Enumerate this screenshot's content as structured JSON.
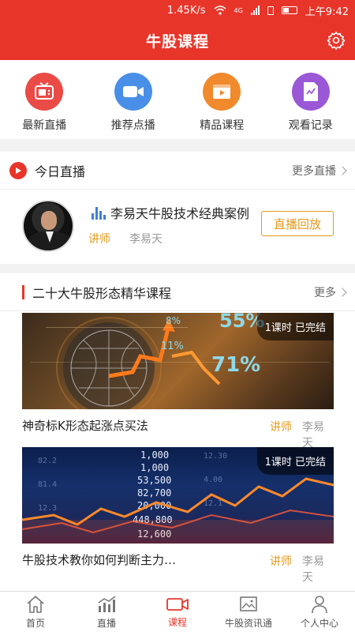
{
  "status": {
    "speed": "1.45K/s",
    "network": "4G",
    "time": "上午9:42"
  },
  "header": {
    "title": "牛股课程"
  },
  "quick_actions": [
    {
      "label": "最新直播",
      "color": "#ea4b47",
      "icon": "tv-icon"
    },
    {
      "label": "推荐点播",
      "color": "#4a8fe7",
      "icon": "video-camera-icon"
    },
    {
      "label": "精品课程",
      "color": "#f08a2c",
      "icon": "film-play-icon"
    },
    {
      "label": "观看记录",
      "color": "#9a58d6",
      "icon": "history-doc-icon"
    }
  ],
  "live_section": {
    "title": "今日直播",
    "more": "更多直播",
    "item": {
      "title": "李易天牛股技术经典案例",
      "teacher_label": "讲师",
      "teacher": "李易天",
      "button": "直播回放"
    }
  },
  "course_section": {
    "title": "二十大牛股形态精华课程",
    "more": "更多",
    "items": [
      {
        "name": "神奇标K形态起涨点买法",
        "badge": "1课时 已完结",
        "teacher_label": "讲师",
        "teacher": "李易天",
        "thumb_text": [
          "55%",
          "71%",
          "11%",
          "8%"
        ]
      },
      {
        "name": "牛股技术教你如何判断主力介入",
        "badge": "1课时 已完结",
        "teacher_label": "讲师",
        "teacher": "李易天",
        "thumb_text": [
          "1,000",
          "1,000",
          "53,500",
          "82,700",
          "20,000",
          "448,800",
          "12,600"
        ]
      }
    ]
  },
  "tabbar": [
    {
      "label": "首页",
      "icon": "home-icon",
      "active": false
    },
    {
      "label": "直播",
      "icon": "chart-icon",
      "active": false
    },
    {
      "label": "课程",
      "icon": "video-icon",
      "active": true
    },
    {
      "label": "牛股资讯通",
      "icon": "image-icon",
      "active": false
    },
    {
      "label": "个人中心",
      "icon": "person-icon",
      "active": false
    }
  ],
  "colors": {
    "brand": "#e8352a",
    "accent": "#e39a1e"
  }
}
